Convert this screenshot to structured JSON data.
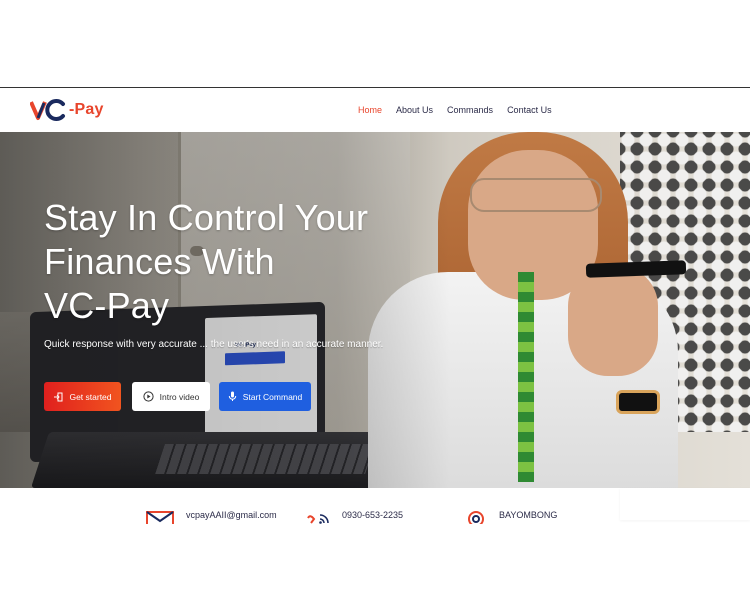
{
  "brand": {
    "logo_text": "-Pay",
    "logo_mark_letters": "VC",
    "colors": {
      "primary_navy": "#1a2a5e",
      "accent_orange": "#e8452c",
      "accent_blue": "#1f5fe0"
    }
  },
  "nav": {
    "items": [
      {
        "label": "Home",
        "active": true
      },
      {
        "label": "About Us",
        "active": false
      },
      {
        "label": "Commands",
        "active": false
      },
      {
        "label": "Contact Us",
        "active": false
      }
    ]
  },
  "hero": {
    "title_line1": "Stay In Control Your",
    "title_line2": "Finances With",
    "title_line3": "VC-Pay",
    "subtitle": "Quick response with very accurate ... the user's need in an accurate manner.",
    "buttons": {
      "get_started": {
        "label": "Get started",
        "icon": "login-icon"
      },
      "intro_video": {
        "label": "Intro video",
        "icon": "play-circle-icon"
      },
      "start_command": {
        "label": "Start Command",
        "icon": "microphone-icon"
      }
    }
  },
  "contacts": {
    "email": {
      "value": "vcpayAAII@gmail.com",
      "icon": "mail-icon"
    },
    "phone": {
      "value": "0930-653-2235",
      "icon": "phone-signal-icon"
    },
    "location": {
      "value": "BAYOMBONG",
      "icon": "location-icon"
    }
  }
}
